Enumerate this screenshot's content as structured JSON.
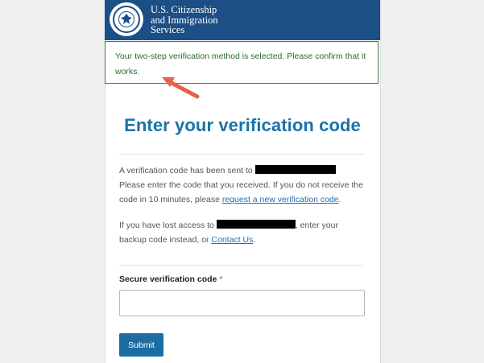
{
  "header": {
    "agency_line1": "U.S. Citizenship",
    "agency_line2": "and Immigration",
    "agency_line3": "Services",
    "logo_icon": "dhs-seal-icon",
    "color": "#1b4f86"
  },
  "alert": {
    "text": "Your two-step verification method is selected. Please confirm that it works.",
    "border_color": "#3e7a3f"
  },
  "annotation": {
    "icon": "arrow-pointer-icon",
    "color": "#e8604c"
  },
  "main": {
    "title": "Enter your verification code",
    "sent_prefix": "A verification code has been sent to",
    "sent_rest": "Please enter the code that you received. If you do not receive the code in 10 minutes, please",
    "request_link": "request a new verification code",
    "sent_end": ".",
    "lost_prefix": "If you have lost access to",
    "lost_rest": ", enter your backup code instead, or",
    "contact_link": "Contact Us",
    "lost_end": ".",
    "field_label": "Secure verification code",
    "required_mark": "*",
    "input_value": "",
    "submit_label": "Submit"
  }
}
